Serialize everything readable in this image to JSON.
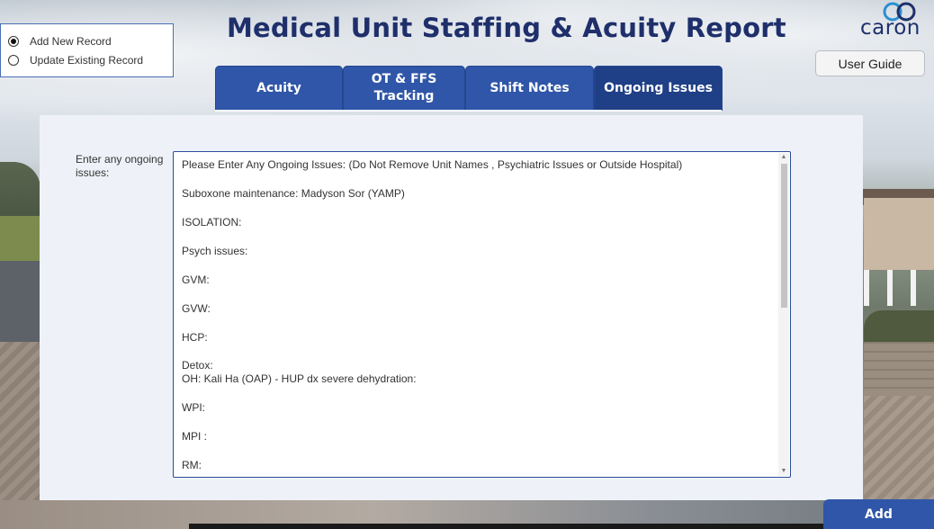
{
  "header": {
    "title": "Medical Unit Staffing & Acuity Report",
    "logo_text": "caron",
    "user_guide_label": "User Guide"
  },
  "record_mode": {
    "options": [
      {
        "label": "Add New Record",
        "selected": true
      },
      {
        "label": "Update Existing Record",
        "selected": false
      }
    ]
  },
  "tabs": [
    {
      "label": "Acuity",
      "active": false
    },
    {
      "label": "OT & FFS\nTracking",
      "active": false
    },
    {
      "label": "Shift Notes",
      "active": false
    },
    {
      "label": "Ongoing Issues",
      "active": true
    }
  ],
  "ongoing_issues": {
    "field_label": "Enter any ongoing issues:",
    "lines": [
      "Please Enter Any Ongoing Issues: (Do Not Remove Unit Names , Psychiatric Issues or Outside Hospital)",
      "",
      "Suboxone maintenance:   Madyson Sor (YAMP)",
      "",
      "ISOLATION:",
      "",
      "Psych issues:",
      "",
      "GVM:",
      "",
      "GVW:",
      "",
      "HCP:",
      "",
      "Detox:",
      "OH:   Kali Ha (OAP) - HUP dx severe dehydration:",
      "",
      "WPI:",
      "",
      "MPI :",
      "",
      "RM:"
    ]
  },
  "footer": {
    "add_label": "Add"
  },
  "colors": {
    "title": "#1e2f6b",
    "tab": "#2f56a8",
    "tab_active": "#1f3f86",
    "panel": "#eef2f8"
  }
}
